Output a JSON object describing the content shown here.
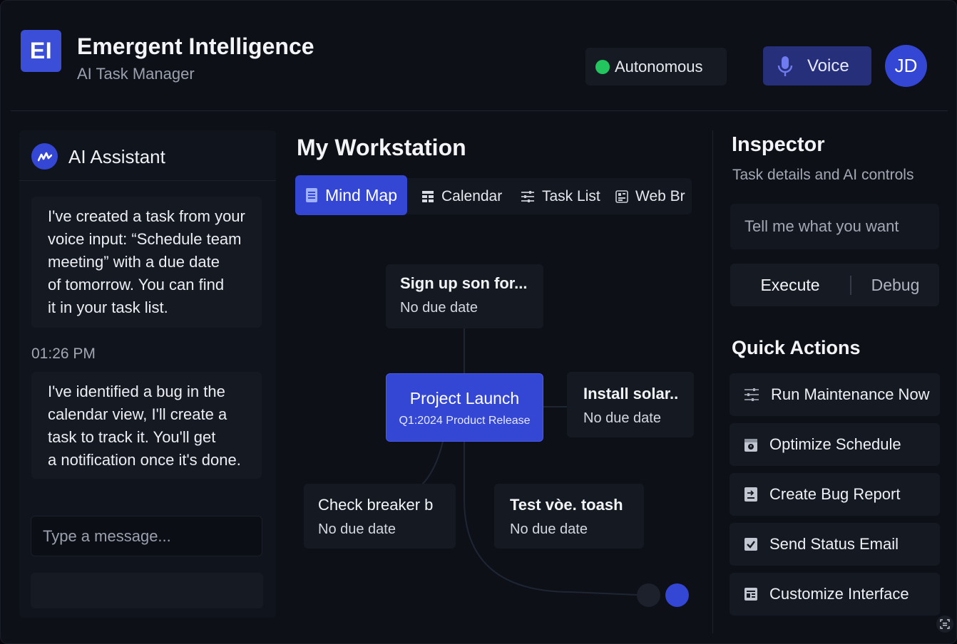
{
  "header": {
    "logo_text": "EI",
    "title": "Emergent Intelligence",
    "subtitle": "AI Task Manager",
    "status_label": "Autonomous",
    "status_color": "#22c55e",
    "voice_label": "Voice",
    "avatar_initials": "JD",
    "accent_color": "#3446d4"
  },
  "assistant": {
    "title": "AI Assistant",
    "messages": [
      {
        "lines": [
          "I've created a task from your",
          "voice input: “Schedule team",
          "meeting” with a due date",
          "of tomorrow. You can find",
          "it in your task list."
        ]
      },
      {
        "time": "01:26 PM",
        "lines": [
          "I've identified a bug in the",
          "calendar view, I'll create a",
          "task to track it. You'll get",
          "a notification once it's done."
        ]
      }
    ],
    "input_placeholder": "Type a message..."
  },
  "workstation": {
    "title": "My Workstation",
    "tabs": [
      {
        "label": "Mind Map",
        "icon": "document-icon",
        "active": true
      },
      {
        "label": "Calendar",
        "icon": "calendar-icon",
        "active": false
      },
      {
        "label": "Task List",
        "icon": "sliders-icon",
        "active": false
      },
      {
        "label": "Web Br",
        "icon": "browser-icon",
        "active": false
      }
    ],
    "mindmap": {
      "center": {
        "title": "Project Launch",
        "subtitle": "Q1:2024 Product Release"
      },
      "nodes": [
        {
          "title": "Sign up son for...",
          "subtitle": "No due date"
        },
        {
          "title": "Install solar..",
          "subtitle": "No due date"
        },
        {
          "title": "Check breaker b",
          "subtitle": "No due date"
        },
        {
          "title": "Test vòe. toash",
          "subtitle": "No due date"
        }
      ]
    }
  },
  "inspector": {
    "title": "Inspector",
    "subtitle": "Task details and AI controls",
    "input_placeholder": "Tell me what you want",
    "execute_label": "Execute",
    "debug_label": "Debug",
    "quick_actions_title": "Quick Actions",
    "quick_actions": [
      {
        "label": "Run Maintenance Now",
        "icon": "sliders-icon"
      },
      {
        "label": "Optimize Schedule",
        "icon": "calendar-clock-icon"
      },
      {
        "label": "Create Bug Report",
        "icon": "report-icon"
      },
      {
        "label": "Send Status Email",
        "icon": "checkbox-icon"
      },
      {
        "label": "Customize Interface",
        "icon": "layout-icon"
      }
    ]
  }
}
